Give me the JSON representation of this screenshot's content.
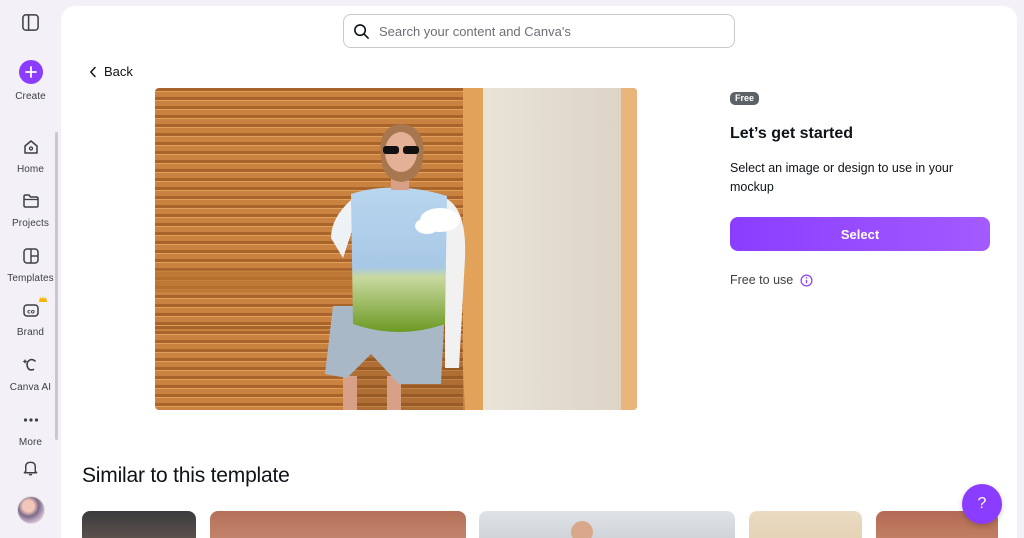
{
  "sidebar": {
    "create_label": "Create",
    "items": [
      {
        "label": "Home",
        "icon": "home-icon"
      },
      {
        "label": "Projects",
        "icon": "folder-icon"
      },
      {
        "label": "Templates",
        "icon": "templates-icon"
      },
      {
        "label": "Brand",
        "icon": "brand-icon"
      },
      {
        "label": "Canva AI",
        "icon": "canva-ai-icon"
      },
      {
        "label": "More",
        "icon": "more-icon"
      }
    ]
  },
  "search": {
    "placeholder": "Search your content and Canva's"
  },
  "back_label": "Back",
  "detail": {
    "badge": "Free",
    "title": "Let’s get started",
    "description": "Select an image or design to use in your mockup",
    "select_label": "Select",
    "free_to_use": "Free to use"
  },
  "similar": {
    "title": "Similar to this template"
  },
  "help_label": "?",
  "colors": {
    "accent": "#8b3dff",
    "badge": "#5d6168"
  }
}
